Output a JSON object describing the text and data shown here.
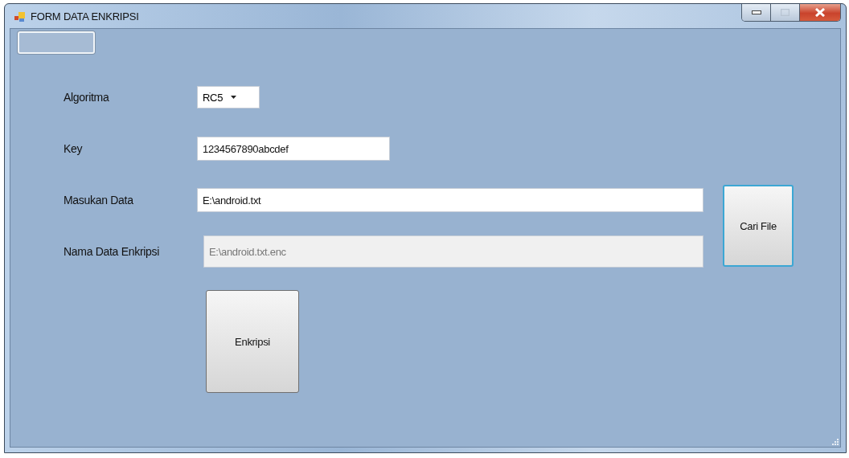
{
  "window": {
    "title": "FORM DATA ENKRIPSI"
  },
  "fields": [
    {
      "label": "Algoritma",
      "kind": "combo",
      "value": "RC5",
      "disabled": false
    },
    {
      "label": "Key",
      "kind": "short",
      "value": "1234567890abcdef",
      "disabled": false
    },
    {
      "label": "Masukan Data",
      "kind": "long",
      "value": "E:\\android.txt",
      "disabled": false
    },
    {
      "label": "Nama Data Enkripsi",
      "kind": "long",
      "value": "E:\\android.txt.enc",
      "disabled": true
    }
  ],
  "browse_button": {
    "label": "Cari File",
    "focused": true
  },
  "submit_button": {
    "label": "Enkripsi",
    "focused": false
  }
}
